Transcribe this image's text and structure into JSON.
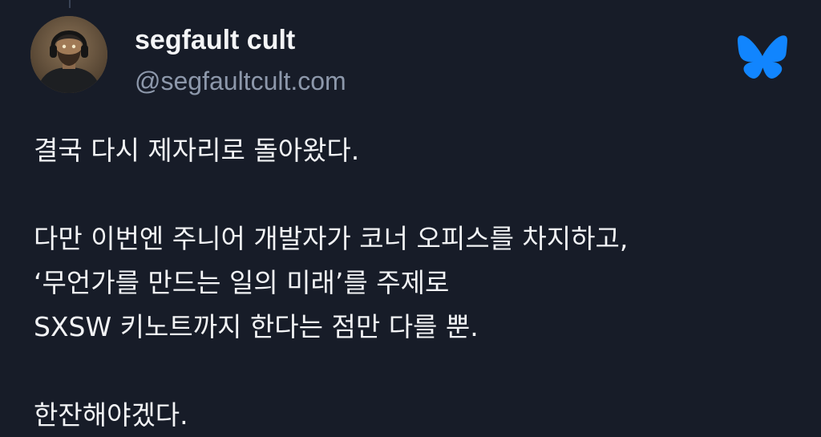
{
  "post": {
    "author": {
      "display_name": "segfault cult",
      "handle": "@segfaultcult.com"
    },
    "platform_icon": "bluesky-butterfly-icon",
    "paragraphs": [
      [
        "결국 다시 제자리로 돌아왔다."
      ],
      [
        "다만 이번엔 주니어 개발자가 코너 오피스를 차지하고,",
        "‘무언가를 만드는 일의 미래’를 주제로",
        "SXSW 키노트까지 한다는 점만 다를 뿐."
      ],
      [
        "한잔해야겠다."
      ]
    ]
  },
  "colors": {
    "background": "#171c28",
    "text": "#f2f3f5",
    "handle": "#8d98ab",
    "brand": "#1185fe"
  }
}
